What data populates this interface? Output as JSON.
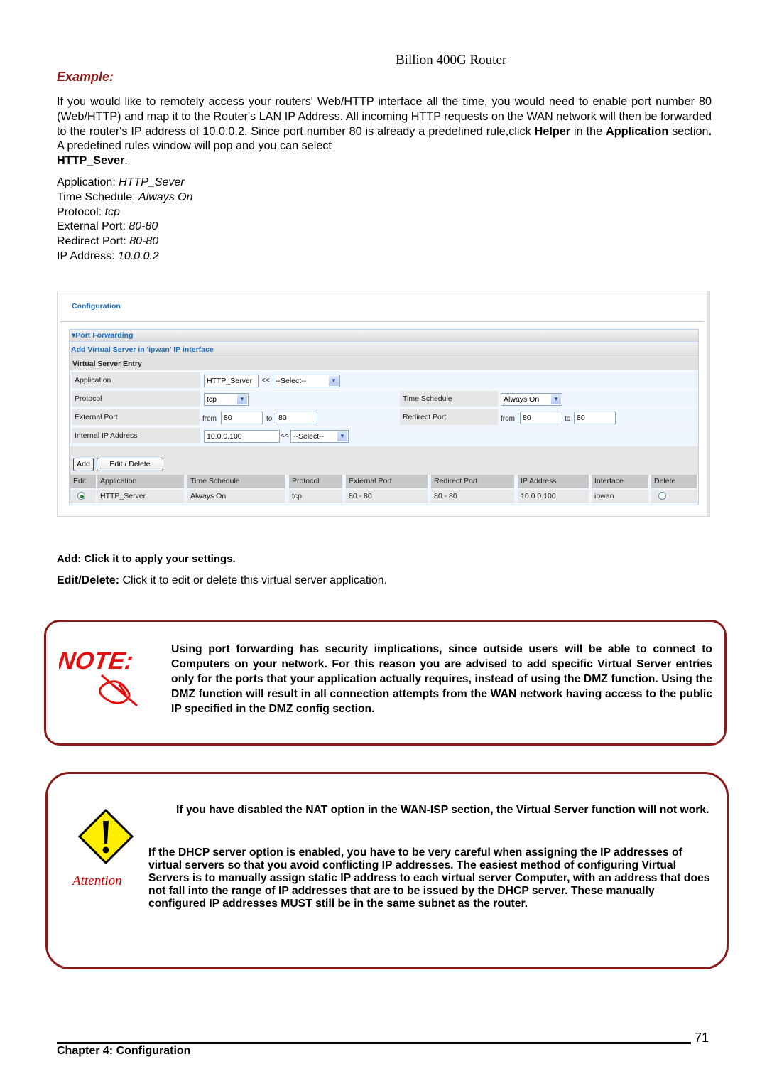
{
  "header": {
    "title": "Billion 400G Router"
  },
  "example": {
    "heading": "Example:",
    "intro_parts": [
      "If you would like to remotely access your routers' Web/HTTP interface all the time, you would need to enable port number 80 (Web/HTTP) and map it to the Router's LAN IP Address. All incoming HTTP requests on the WAN network will then be forwarded to the router's IP address of 10.0.0.2. Since port number 80 is already a predefined rule,click ",
      "Helper",
      " in the ",
      "Application",
      " section",
      ".",
      " A predefined rules window will pop and you can select ",
      "HTTP_Sever",
      "."
    ]
  },
  "params": [
    {
      "label": "Application: ",
      "value": "HTTP_Sever"
    },
    {
      "label": "Time Schedule: ",
      "value": "Always On"
    },
    {
      "label": "Protocol: ",
      "value": "tcp"
    },
    {
      "label": "External Port: ",
      "value": "80-80"
    },
    {
      "label": "Redirect Port: ",
      "value": "80-80"
    },
    {
      "label": "IP Address: ",
      "value": "10.0.0.2"
    }
  ],
  "ui": {
    "config_title": "Configuration",
    "port_forwarding": "▾Port Forwarding",
    "add_virtual_server": "Add Virtual Server in 'ipwan' IP interface",
    "entry_title": "Virtual Server Entry",
    "fields": {
      "application_label": "Application",
      "application_value": "HTTP_Server",
      "app_select": "--Select--",
      "protocol_label": "Protocol",
      "protocol_value": "tcp",
      "time_schedule_label": "Time Schedule",
      "time_schedule_value": "Always On",
      "external_port_label": "External Port",
      "external_from": "80",
      "external_to": "80",
      "redirect_port_label": "Redirect Port",
      "redirect_from": "80",
      "redirect_to": "80",
      "internal_ip_label": "Internal IP Address",
      "internal_ip_value": "10.0.0.100",
      "ip_select": "--Select--",
      "from_text": "from",
      "to_text": "to",
      "arrows": "<<"
    },
    "buttons": {
      "add": "Add",
      "edit_delete": "Edit / Delete"
    },
    "table": {
      "headers": [
        "Edit",
        "Application",
        "Time Schedule",
        "Protocol",
        "External Port",
        "Redirect Port",
        "IP Address",
        "Interface",
        "Delete"
      ],
      "rows": [
        {
          "application": "HTTP_Server",
          "time_schedule": "Always On",
          "protocol": "tcp",
          "external_port": "80 - 80",
          "redirect_port": "80 - 80",
          "ip_address": "10.0.0.100",
          "interface": "ipwan",
          "edit_selected": true,
          "delete_selected": false
        }
      ]
    }
  },
  "descriptions": {
    "add": "Add: Click it to apply your settings.",
    "edit_delete_label": "Edit/Delete:",
    "edit_delete_text": " Click it to edit or delete this virtual server application."
  },
  "note": {
    "logo_text": "NOTE:",
    "text": "Using port forwarding has security implications, since outside users will be able to connect to Computers on your network. For this reason you are advised to add specific Virtual Server entries only for the ports that your application actually requires, instead of using the DMZ function. Using the DMZ function will result in all connection attempts from the WAN network having access to the public IP specified in the DMZ config section."
  },
  "attention": {
    "label": "Attention",
    "p1": "If you have disabled the NAT option in the WAN-ISP section, the Virtual Server function will not work.",
    "p2": "If the DHCP server option is enabled, you have to be very careful when assigning the IP addresses of virtual servers so that you avoid conflicting IP addresses. The easiest method of configuring Virtual Servers is to manually assign static IP address to each virtual server Computer, with an address that does not fall into the range of IP addresses that are to be issued by the DHCP server. These manually configured IP addresses MUST still be in the same subnet as the router."
  },
  "footer": {
    "page_number": "71",
    "chapter": "Chapter 4: Configuration"
  }
}
